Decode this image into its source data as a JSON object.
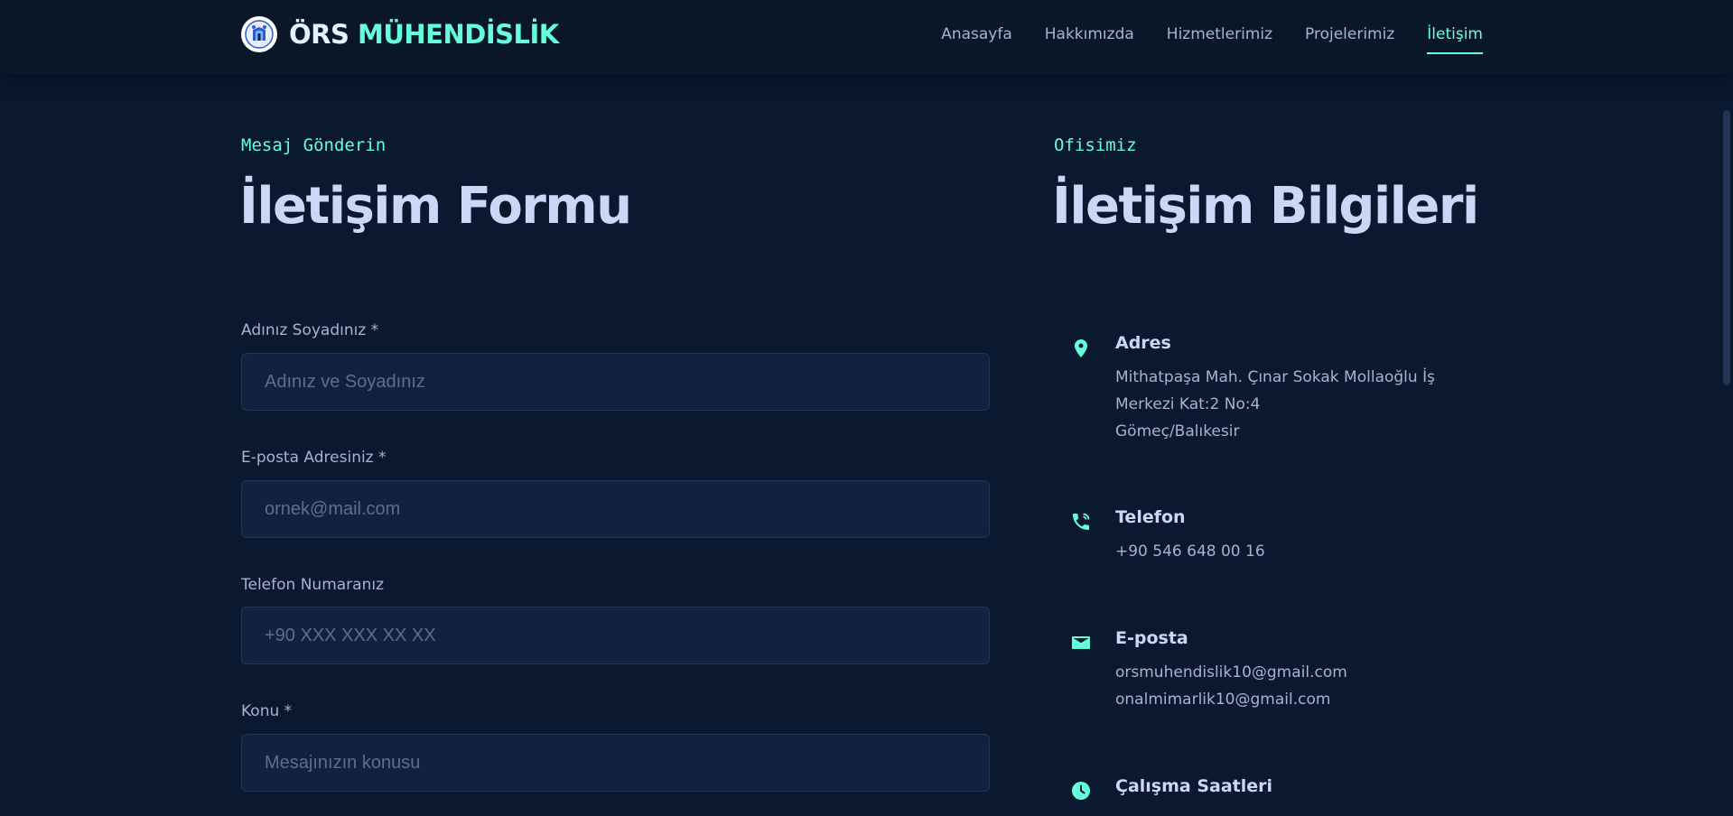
{
  "header": {
    "logo_first": "ÖRS",
    "logo_second": "MÜHENDİSLİK",
    "nav": [
      {
        "label": "Anasayfa"
      },
      {
        "label": "Hakkımızda"
      },
      {
        "label": "Hizmetlerimiz"
      },
      {
        "label": "Projelerimiz"
      },
      {
        "label": "İletişim",
        "active": true
      }
    ]
  },
  "form": {
    "eyebrow": "Mesaj Gönderin",
    "title": "İletişim Formu",
    "fields": [
      {
        "label": "Adınız Soyadınız *",
        "placeholder": "Adınız ve Soyadınız",
        "value": ""
      },
      {
        "label": "E-posta Adresiniz *",
        "placeholder": "ornek@mail.com",
        "value": ""
      },
      {
        "label": "Telefon Numaranız",
        "placeholder": "+90 XXX XXX XX XX",
        "value": ""
      },
      {
        "label": "Konu *",
        "placeholder": "Mesajınızın konusu",
        "value": ""
      }
    ]
  },
  "contact": {
    "eyebrow": "Ofisimiz",
    "title": "İletişim Bilgileri",
    "items": [
      {
        "icon": "location-pin-icon",
        "title": "Adres",
        "lines": [
          "Mithatpaşa Mah. Çınar Sokak Mollaoğlu İş",
          "Merkezi Kat:2 No:4",
          "Gömeç/Balıkesir"
        ]
      },
      {
        "icon": "phone-icon",
        "title": "Telefon",
        "lines": [
          "+90 546 648 00 16"
        ]
      },
      {
        "icon": "mail-icon",
        "title": "E-posta",
        "lines": [
          "orsmuhendislik10@gmail.com",
          "onalmimarlik10@gmail.com"
        ]
      },
      {
        "icon": "clock-icon",
        "title": "Çalışma Saatleri",
        "lines": []
      }
    ]
  },
  "colors": {
    "background": "#0a192f",
    "accent": "#64ffda",
    "input_bg": "#112240",
    "text_primary": "#ccd6f6",
    "text_secondary": "#a8b2d1"
  }
}
